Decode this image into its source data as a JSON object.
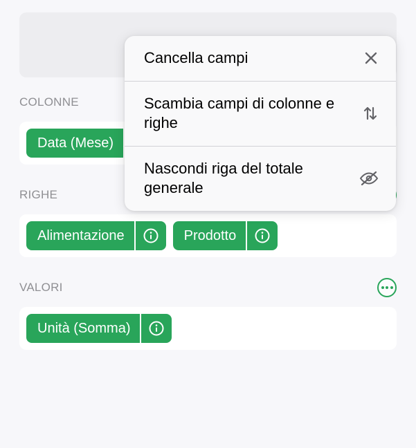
{
  "sections": {
    "colonne": {
      "label": "COLONNE",
      "items": [
        "Data (Mese)"
      ]
    },
    "righe": {
      "label": "RIGHE",
      "items": [
        "Alimentazione",
        "Prodotto"
      ]
    },
    "valori": {
      "label": "VALORI",
      "items": [
        "Unità (Somma)"
      ]
    }
  },
  "popover": {
    "cancella": "Cancella campi",
    "scambia": "Scambia campi di colonne e righe",
    "nascondi": "Nascondi riga del totale generale"
  },
  "colors": {
    "accent": "#29a55a"
  }
}
